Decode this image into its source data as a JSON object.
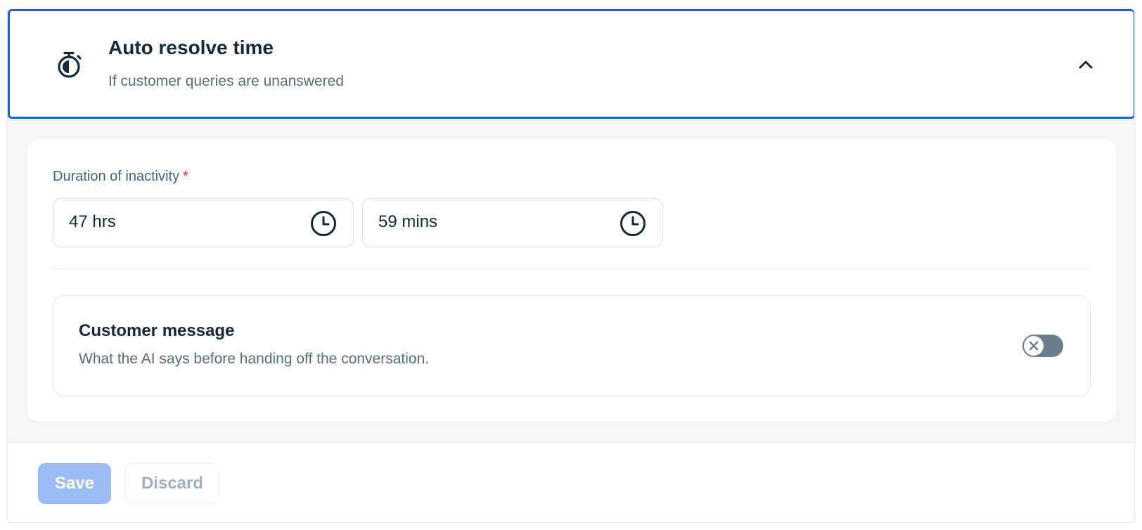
{
  "header": {
    "title": "Auto resolve time",
    "subtitle": "If customer queries are unanswered",
    "icon": "stopwatch-icon",
    "toggle_icon": "chevron-up-icon",
    "expanded": true
  },
  "duration": {
    "label": "Duration of inactivity",
    "required_mark": "*",
    "hours": {
      "value": "47 hrs",
      "icon": "clock-icon"
    },
    "minutes": {
      "value": "59 mins",
      "icon": "clock-icon"
    }
  },
  "customer_message": {
    "title": "Customer message",
    "description": "What the AI says before handing off the conversation.",
    "enabled": false
  },
  "footer": {
    "save_label": "Save",
    "discard_label": "Discard",
    "save_disabled": true,
    "discard_disabled": true
  },
  "colors": {
    "accent_border": "#1a66cc",
    "required": "#d32a2a",
    "save_disabled_bg": "#9bbcf4",
    "toggle_off": "#6b7e90",
    "text_primary": "#13293d",
    "text_secondary": "#5a6b7c"
  }
}
